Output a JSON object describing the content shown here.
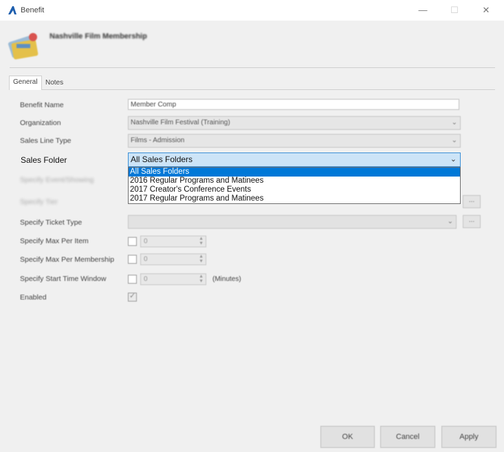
{
  "window": {
    "title": "Benefit",
    "minimize": "—",
    "maximize": "☐",
    "close": "✕"
  },
  "header": {
    "title": "Nashville Film Membership"
  },
  "tabs": [
    {
      "label": "General"
    },
    {
      "label": "Notes"
    }
  ],
  "form": {
    "benefit_name": {
      "label": "Benefit Name",
      "value": "Member Comp"
    },
    "organization": {
      "label": "Organization",
      "value": "Nashville Film Festival (Training)"
    },
    "sales_line_type": {
      "label": "Sales Line Type",
      "value": "Films - Admission"
    },
    "sales_folder": {
      "label": "Sales Folder",
      "value": "All Sales Folders",
      "options": [
        "All Sales Folders",
        "2016 Regular Programs and Matinees",
        "2017 Creator's Conference Events",
        "2017 Regular Programs and Matinees"
      ]
    },
    "specify_event_showing": {
      "label": "Specify Event/Showing"
    },
    "specify_tier": {
      "label": "Specify Tier"
    },
    "specify_ticket_type": {
      "label": "Specify Ticket Type"
    },
    "specify_max_per_item": {
      "label": "Specify Max Per Item",
      "value": "0"
    },
    "specify_max_per_membership": {
      "label": "Specify Max Per Membership",
      "value": "0"
    },
    "specify_start_time_window": {
      "label": "Specify Start Time Window",
      "value": "0",
      "unit": "(Minutes)"
    },
    "enabled": {
      "label": "Enabled"
    },
    "ellipsis": "..."
  },
  "buttons": {
    "ok": "OK",
    "cancel": "Cancel",
    "apply": "Apply"
  },
  "colors": {
    "accent": "#0078d7",
    "focus_border": "#3b8fd6"
  }
}
